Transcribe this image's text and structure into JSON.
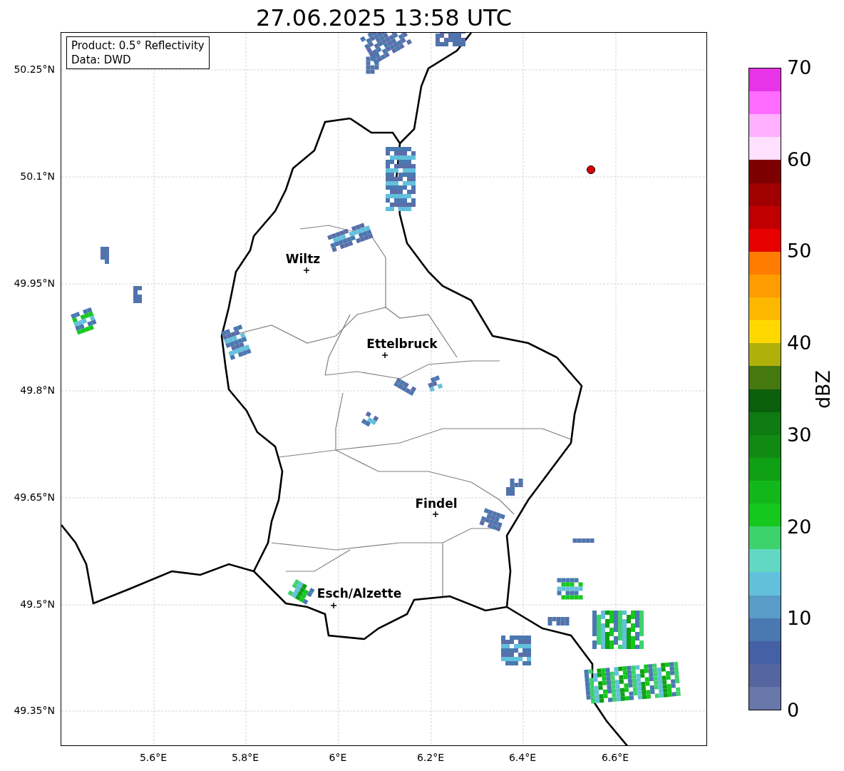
{
  "title": "27.06.2025 13:58 UTC",
  "info_box": [
    "Product: 0.5° Reflectivity",
    "Data: DWD"
  ],
  "y_ticks": [
    "50.25°N",
    "50.1°N",
    "49.95°N",
    "49.8°N",
    "49.65°N",
    "49.5°N",
    "49.35°N"
  ],
  "x_ticks": [
    "5.6°E",
    "5.8°E",
    "6°E",
    "6.2°E",
    "6.4°E",
    "6.6°E"
  ],
  "cities": [
    {
      "name": "Wiltz"
    },
    {
      "name": "Ettelbruck"
    },
    {
      "name": "Findel"
    },
    {
      "name": "Esch/Alzette"
    }
  ],
  "colorbar": {
    "label": "dBZ",
    "ticks": [
      "70",
      "60",
      "50",
      "40",
      "30",
      "20",
      "10",
      "0"
    ],
    "segments": [
      {
        "color": "#e834e8"
      },
      {
        "color": "#ff6cff"
      },
      {
        "color": "#ffb0ff"
      },
      {
        "color": "#ffe0ff"
      },
      {
        "color": "#7c0000"
      },
      {
        "color": "#a00000"
      },
      {
        "color": "#c00000"
      },
      {
        "color": "#e60000"
      },
      {
        "color": "#ff7c00"
      },
      {
        "color": "#ff9c00"
      },
      {
        "color": "#ffb800"
      },
      {
        "color": "#ffd800"
      },
      {
        "color": "#b0b00a"
      },
      {
        "color": "#467810"
      },
      {
        "color": "#0a5e0c"
      },
      {
        "color": "#0e7a12"
      },
      {
        "color": "#108a12"
      },
      {
        "color": "#10a014"
      },
      {
        "color": "#12b81a"
      },
      {
        "color": "#14c81e"
      },
      {
        "color": "#3ed26c"
      },
      {
        "color": "#60d8c4"
      },
      {
        "color": "#62c0dc"
      },
      {
        "color": "#5a9cc8"
      },
      {
        "color": "#4a78b0"
      },
      {
        "color": "#4560a5"
      },
      {
        "color": "#5565a0"
      },
      {
        "color": "#6877a9"
      }
    ]
  }
}
